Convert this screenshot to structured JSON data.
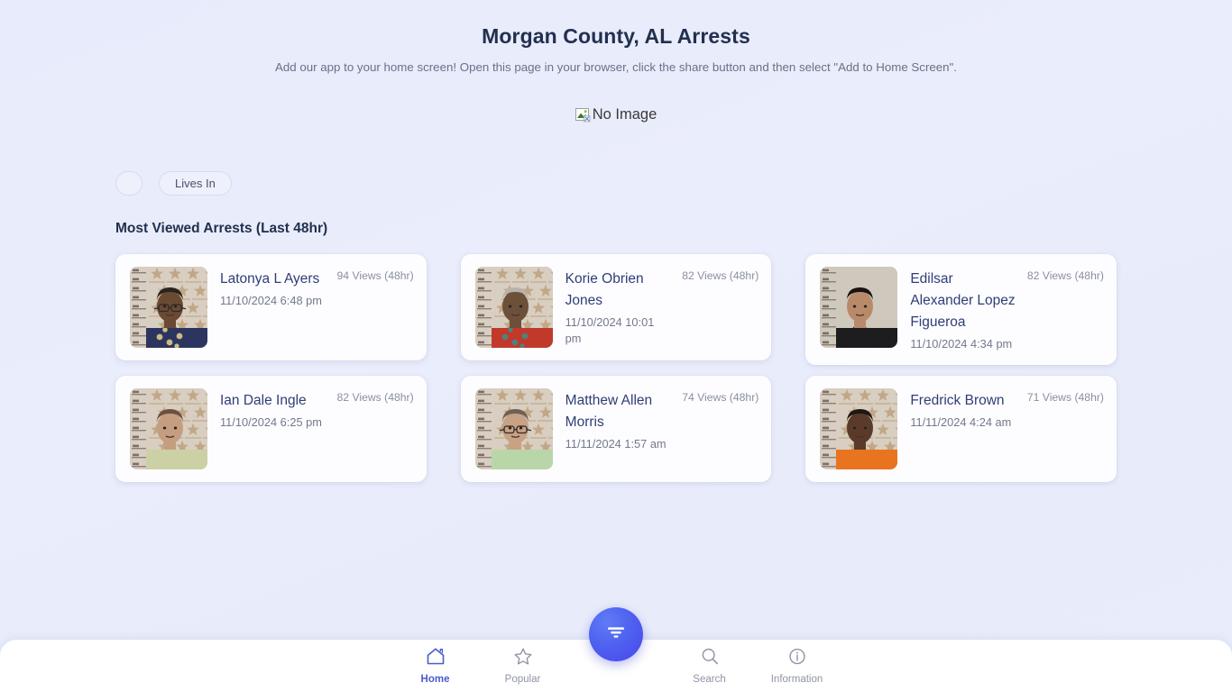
{
  "header": {
    "title": "Morgan County, AL Arrests",
    "subtitle": "Add our app to your home screen! Open this page in your browser, click the share button and then select \"Add to Home Screen\"."
  },
  "hero": {
    "broken_image_alt": "No Image"
  },
  "filters": {
    "pills": [
      {
        "label": "",
        "name": "filter-pill-empty"
      },
      {
        "label": "Lives In",
        "name": "filter-pill-lives-in"
      }
    ]
  },
  "section": {
    "heading": "Most Viewed Arrests (Last 48hr)"
  },
  "arrests": [
    {
      "name": "Latonya L Ayers",
      "date": "11/10/2024 6:48 pm",
      "views": "94 Views (48hr)",
      "skin": "#6b4a33",
      "shirt": "#2c3560",
      "shirt2": "#e8d488",
      "hair": "#2a2320",
      "glasses": true,
      "backdrop": "star"
    },
    {
      "name": "Korie Obrien Jones",
      "date": "11/10/2024 10:01 pm",
      "views": "82 Views (48hr)",
      "skin": "#6d5039",
      "shirt": "#c0392b",
      "shirt2": "#3e8f8a",
      "hair": "#b9b2ab",
      "glasses": false,
      "backdrop": "star"
    },
    {
      "name": "Edilsar Alexander Lopez Figueroa",
      "date": "11/10/2024 4:34 pm",
      "views": "82 Views (48hr)",
      "skin": "#b98a6a",
      "shirt": "#1d1d1f",
      "shirt2": "#1d1d1f",
      "hair": "#191412",
      "glasses": false,
      "backdrop": "plain"
    },
    {
      "name": "Ian Dale Ingle",
      "date": "11/10/2024 6:25 pm",
      "views": "82 Views (48hr)",
      "skin": "#c59d80",
      "shirt": "#ccd0a5",
      "shirt2": "#ccd0a5",
      "hair": "#6a5140",
      "glasses": false,
      "backdrop": "star"
    },
    {
      "name": "Matthew Allen Morris",
      "date": "11/11/2024 1:57 am",
      "views": "74 Views (48hr)",
      "skin": "#c9a184",
      "shirt": "#b9d6a8",
      "shirt2": "#b9d6a8",
      "hair": "#6e6058",
      "glasses": true,
      "backdrop": "star"
    },
    {
      "name": "Fredrick Brown",
      "date": "11/11/2024 4:24 am",
      "views": "71 Views (48hr)",
      "skin": "#5a3b29",
      "shirt": "#e8741f",
      "shirt2": "#e8741f",
      "hair": "#1e1815",
      "glasses": false,
      "backdrop": "star"
    }
  ],
  "bottom_nav": {
    "items": [
      {
        "label": "Home",
        "icon": "home-icon",
        "active": true
      },
      {
        "label": "Popular",
        "icon": "star-icon",
        "active": false
      },
      {
        "label": "Search",
        "icon": "search-icon",
        "active": false
      },
      {
        "label": "Information",
        "icon": "info-icon",
        "active": false
      }
    ],
    "fab": {
      "icon": "filter-funnel-icon"
    }
  },
  "colors": {
    "accent": "#4b5ccc",
    "name_link": "#2f3d77",
    "page_bg": "#e9edfb",
    "card_bg": "#fdfdff",
    "muted_text": "#8a8f9f"
  }
}
